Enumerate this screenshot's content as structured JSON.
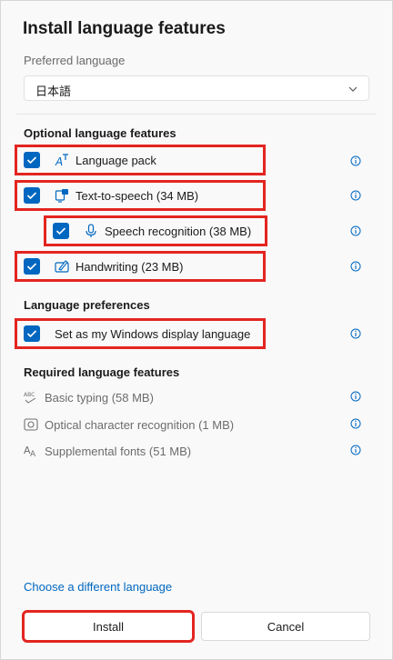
{
  "dialog": {
    "title": "Install language features",
    "preferred_label": "Preferred language",
    "preferred_value": "日本語"
  },
  "optional": {
    "heading": "Optional language features",
    "items": [
      {
        "label": "Language pack",
        "checked": true,
        "icon": "language-pack-icon"
      },
      {
        "label": "Text-to-speech (34 MB)",
        "checked": true,
        "icon": "text-to-speech-icon"
      },
      {
        "label": "Speech recognition (38 MB)",
        "checked": true,
        "icon": "microphone-icon"
      },
      {
        "label": "Handwriting (23 MB)",
        "checked": true,
        "icon": "handwriting-icon"
      }
    ]
  },
  "preferences": {
    "heading": "Language preferences",
    "display_label": "Set as my Windows display language",
    "checked": true
  },
  "required": {
    "heading": "Required language features",
    "items": [
      {
        "label": "Basic typing (58 MB)",
        "icon": "abc-spellcheck-icon"
      },
      {
        "label": "Optical character recognition (1 MB)",
        "icon": "camera-ocr-icon"
      },
      {
        "label": "Supplemental fonts (51 MB)",
        "icon": "font-icon"
      }
    ]
  },
  "footer": {
    "link": "Choose a different language",
    "install": "Install",
    "cancel": "Cancel"
  },
  "colors": {
    "accent": "#0067c0",
    "highlight": "#e32520"
  }
}
